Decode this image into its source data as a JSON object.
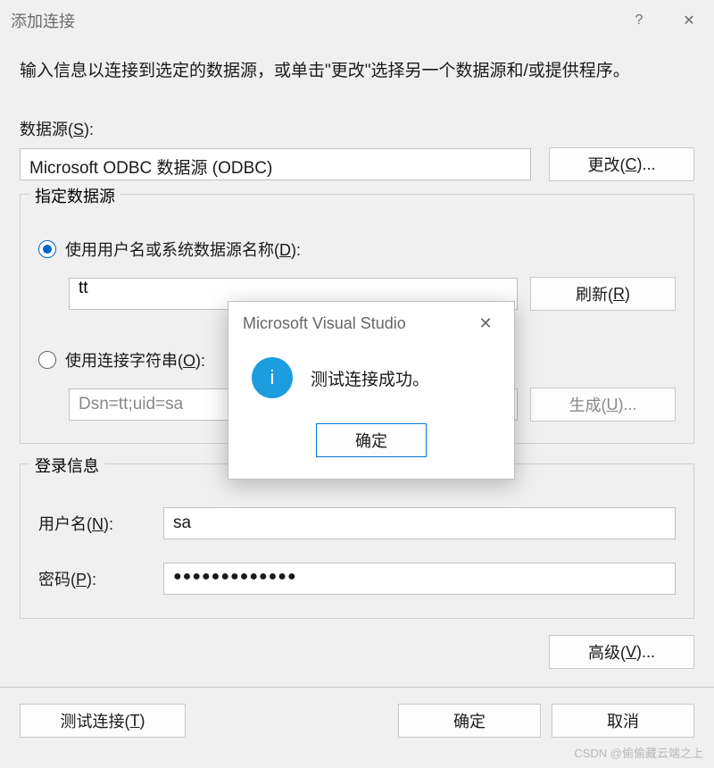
{
  "dialog": {
    "title": "添加连接",
    "help": "?",
    "close": "✕",
    "instruction": "输入信息以连接到选定的数据源，或单击\"更改\"选择另一个数据源和/或提供程序。",
    "datasource_label_pre": "数据源(",
    "datasource_label_key": "S",
    "datasource_label_post": "):",
    "datasource_value": "Microsoft ODBC 数据源 (ODBC)",
    "change_pre": "更改(",
    "change_key": "C",
    "change_post": ")..."
  },
  "specify": {
    "legend": "指定数据源",
    "radio1_pre": "使用用户名或系统数据源名称(",
    "radio1_key": "D",
    "radio1_post": "):",
    "dsn_value": "tt",
    "refresh_pre": "刷新(",
    "refresh_key": "R",
    "refresh_post": ")",
    "radio2_pre": "使用连接字符串(",
    "radio2_key": "O",
    "radio2_post": "):",
    "conn_value": "Dsn=tt;uid=sa",
    "build_pre": "生成(",
    "build_key": "U",
    "build_post": ")..."
  },
  "login": {
    "legend": "登录信息",
    "user_pre": "用户名(",
    "user_key": "N",
    "user_post": "):",
    "user_value": "sa",
    "pwd_pre": "密码(",
    "pwd_key": "P",
    "pwd_post": "):",
    "pwd_value": "●●●●●●●●●●●●●"
  },
  "advanced_pre": "高级(",
  "advanced_key": "V",
  "advanced_post": ")...",
  "test_pre": "测试连接(",
  "test_key": "T",
  "test_post": ")",
  "ok": "确定",
  "cancel": "取消",
  "watermark": "CSDN @偷偷藏云端之上",
  "popup": {
    "title": "Microsoft Visual Studio",
    "close": "✕",
    "icon_glyph": "i",
    "message": "测试连接成功。",
    "ok": "确定"
  }
}
